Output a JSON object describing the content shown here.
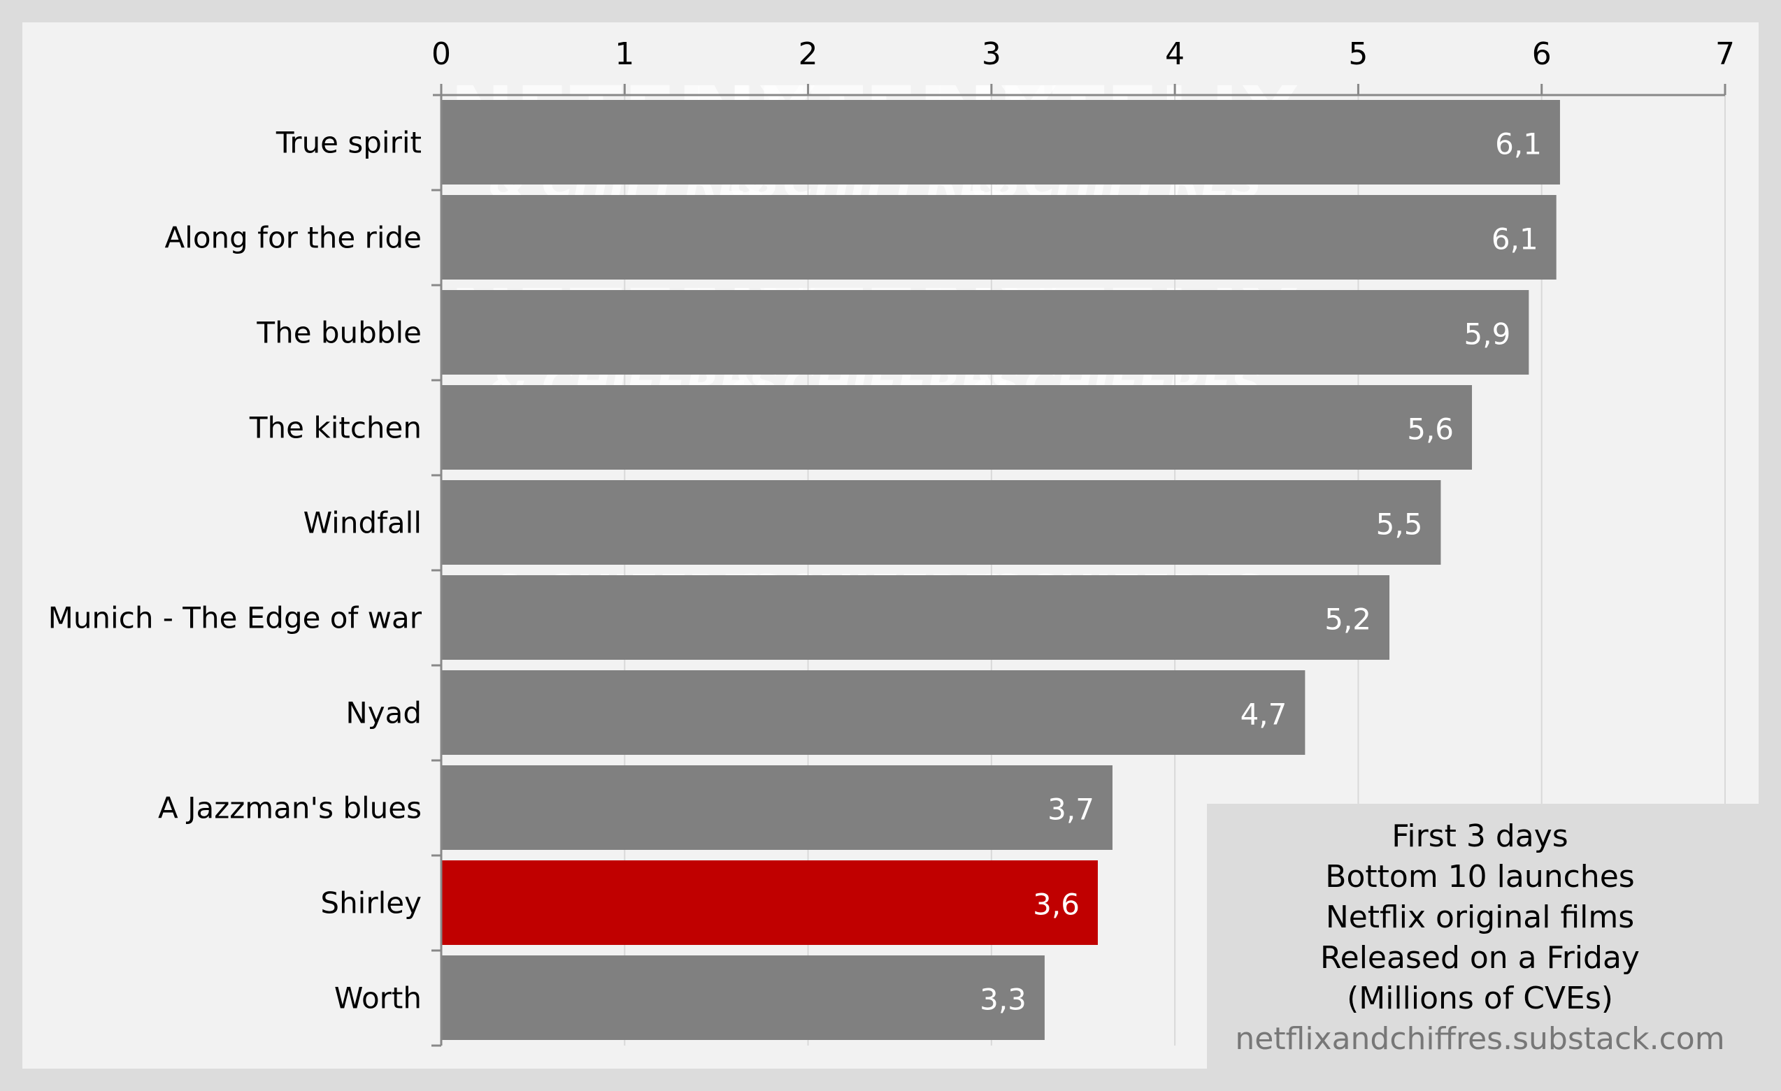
{
  "chart_data": {
    "type": "bar",
    "orientation": "horizontal",
    "title": "",
    "xlabel": "",
    "ylabel": "",
    "xlim": [
      0,
      7
    ],
    "x_ticks": [
      "0",
      "1",
      "2",
      "3",
      "4",
      "5",
      "6",
      "7"
    ],
    "x_axis_position": "top",
    "grid": true,
    "categories": [
      "True spirit",
      "Along for the ride",
      "The bubble",
      "The kitchen",
      "Windfall",
      "Munich - The Edge of war",
      "Nyad",
      "A Jazzman's blues",
      "Shirley",
      "Worth"
    ],
    "values": [
      6.1,
      6.08,
      5.93,
      5.62,
      5.45,
      5.17,
      4.71,
      3.66,
      3.58,
      3.29
    ],
    "data_labels": [
      "6,1",
      "6,1",
      "5,9",
      "5,6",
      "5,5",
      "5,2",
      "4,7",
      "3,7",
      "3,6",
      "3,3"
    ],
    "highlight_category": "Shirley",
    "colors": {
      "bar": "#808080",
      "highlight": "#c00000",
      "panel": "#f2f2f2",
      "background": "#dcdcdc",
      "axis": "#888888",
      "grid": "#d9d9d9"
    },
    "annotation_lines": [
      "First 3 days",
      "Bottom 10 launches",
      "Netflix original films",
      "Released on a Friday",
      "(Millions of CVEs)"
    ],
    "source": "netflixandchiffres.substack.com",
    "annotation_position": "bottom-right",
    "watermark": {
      "line1": "NETFLIX",
      "line2": "& CHIFFRES"
    }
  }
}
